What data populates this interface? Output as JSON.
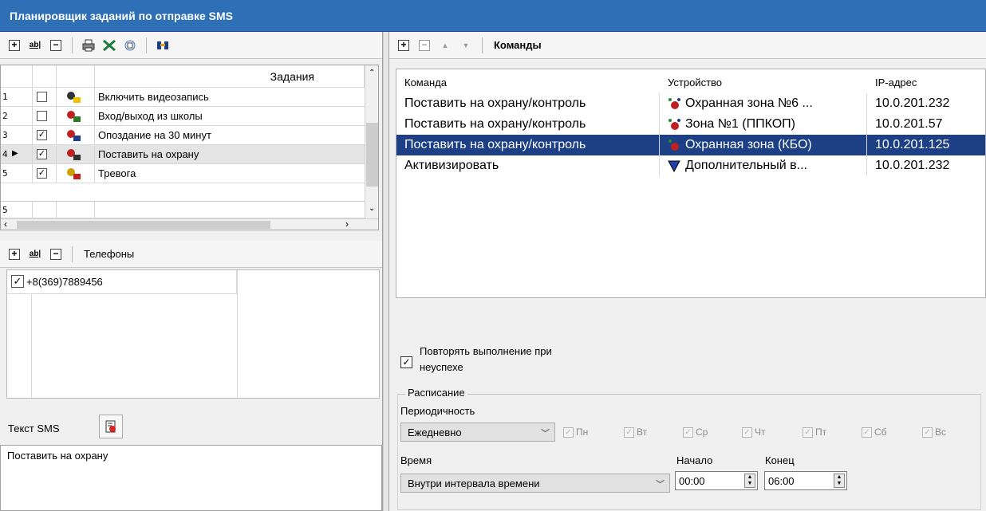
{
  "window": {
    "title": "Планировщик заданий по отправке SMS"
  },
  "tasks": {
    "header": "Задания",
    "rows": [
      {
        "num": "1",
        "checked": false,
        "icon": "camera-record-icon",
        "label": "Включить видеозапись"
      },
      {
        "num": "2",
        "checked": false,
        "icon": "person-entry-icon",
        "label": "Вход/выход из школы"
      },
      {
        "num": "3",
        "checked": true,
        "icon": "person-late-icon",
        "label": "Опоздание на 30 минут"
      },
      {
        "num": "4",
        "checked": true,
        "icon": "alarm-clock-icon",
        "label": "Поставить на охрану",
        "current": true
      },
      {
        "num": "5",
        "checked": true,
        "icon": "alarm-bell-icon",
        "label": "Тревога"
      }
    ],
    "footer_num": "5"
  },
  "phones": {
    "label": "Телефоны",
    "items": [
      {
        "checked": true,
        "number": "+8(369)7889456"
      }
    ]
  },
  "sms": {
    "label": "Текст SMS",
    "text": "Поставить на охрану"
  },
  "commands": {
    "label": "Команды",
    "columns": [
      "Команда",
      "Устройство",
      "IP-адрес"
    ],
    "rows": [
      {
        "command": "Поставить на охрану/контроль",
        "device_icon": "security-zone-icon",
        "device": "Охранная зона №6 ...",
        "ip": "10.0.201.232",
        "selected": false
      },
      {
        "command": "Поставить на охрану/контроль",
        "device_icon": "security-zone-icon",
        "device": "Зона №1 (ППКОП)",
        "ip": "10.0.201.57",
        "selected": false
      },
      {
        "command": "Поставить на охрану/контроль",
        "device_icon": "security-zone-icon",
        "device": "Охранная зона (КБО)",
        "ip": "10.0.201.125",
        "selected": true
      },
      {
        "command": "Активизировать",
        "device_icon": "shield-device-icon",
        "device": "Дополнительный в...",
        "ip": "10.0.201.232",
        "selected": false
      }
    ]
  },
  "options": {
    "repeat_label_line1": "Повторять выполнение при",
    "repeat_label_line2": "неуспехе",
    "repeat_checked": true
  },
  "schedule": {
    "group_label": "Расписание",
    "period_label": "Периодичность",
    "period_value": "Ежедневно",
    "days": [
      "Пн",
      "Вт",
      "Ср",
      "Чт",
      "Пт",
      "Сб",
      "Вс"
    ],
    "time_label": "Время",
    "time_value": "Внутри интервала времени",
    "start_label": "Начало",
    "start_value": "00:00",
    "end_label": "Конец",
    "end_value": "06:00"
  }
}
